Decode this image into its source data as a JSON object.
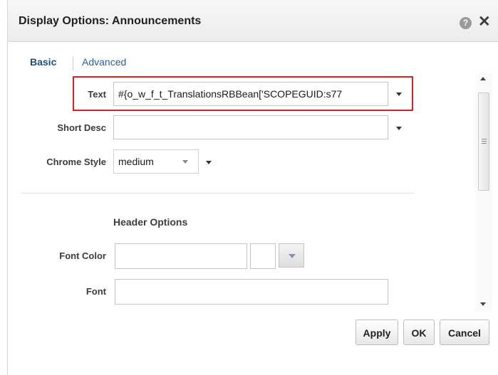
{
  "dialog": {
    "title": "Display Options: Announcements",
    "help_glyph": "?",
    "close_glyph": "✕"
  },
  "tabs": [
    {
      "label": "Basic",
      "selected": true
    },
    {
      "label": "Advanced",
      "selected": false
    }
  ],
  "basic": {
    "text": {
      "label": "Text",
      "value": "#{o_w_f_t_TranslationsRBBean['SCOPEGUID:s77"
    },
    "short_desc": {
      "label": "Short Desc",
      "value": ""
    },
    "chrome_style": {
      "label": "Chrome Style",
      "value": "medium"
    },
    "header_options": {
      "title": "Header Options",
      "font_color": {
        "label": "Font Color",
        "value": ""
      },
      "font": {
        "label": "Font",
        "value": ""
      }
    }
  },
  "buttons": {
    "apply": "Apply",
    "ok": "OK",
    "cancel": "Cancel"
  },
  "colors": {
    "highlight": "#e02020",
    "tab_selected": "#1f4f7f",
    "tab_link": "#2b5f99"
  },
  "icons": {
    "help": "help-icon",
    "close": "close-icon",
    "dropdown": "chevron-down-icon",
    "scroll_up": "scroll-up-icon",
    "scroll_down": "scroll-down-icon"
  }
}
